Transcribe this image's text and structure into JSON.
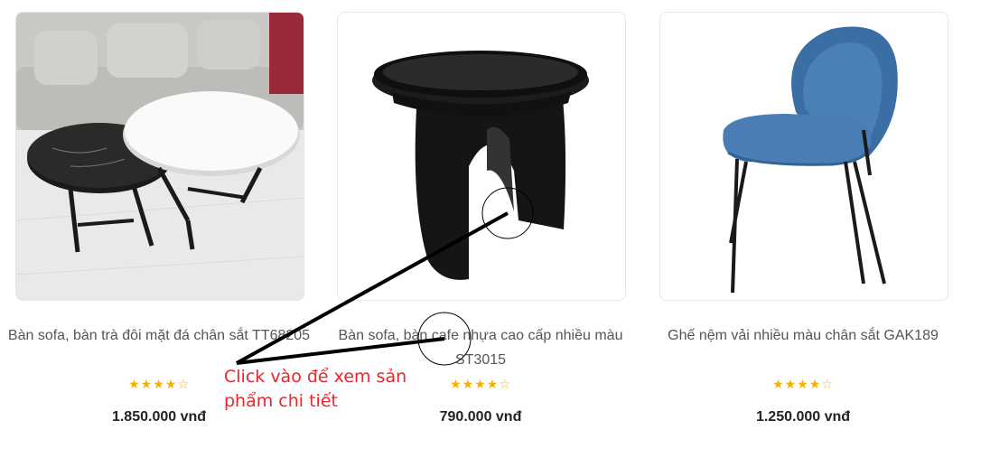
{
  "products": [
    {
      "name": "Bàn sofa, bàn trà đôi mặt đá chân sắt TT68205",
      "rating": "★★★★☆",
      "price": "1.850.000 vnđ"
    },
    {
      "name": "Bàn sofa, bàn cafe nhựa cao cấp nhiều màu ST3015",
      "rating": "★★★★☆",
      "price": "790.000 vnđ"
    },
    {
      "name": "Ghế nệm vải nhiều màu chân sắt GAK189",
      "rating": "★★★★☆",
      "price": "1.250.000 vnđ"
    }
  ],
  "annotation": {
    "line1": "Click vào để xem sản",
    "line2": "phẩm chi tiết",
    "color": "#e8262b"
  },
  "colors": {
    "star": "#f5b000",
    "border": "#e6e6e6",
    "price": "#222222"
  }
}
